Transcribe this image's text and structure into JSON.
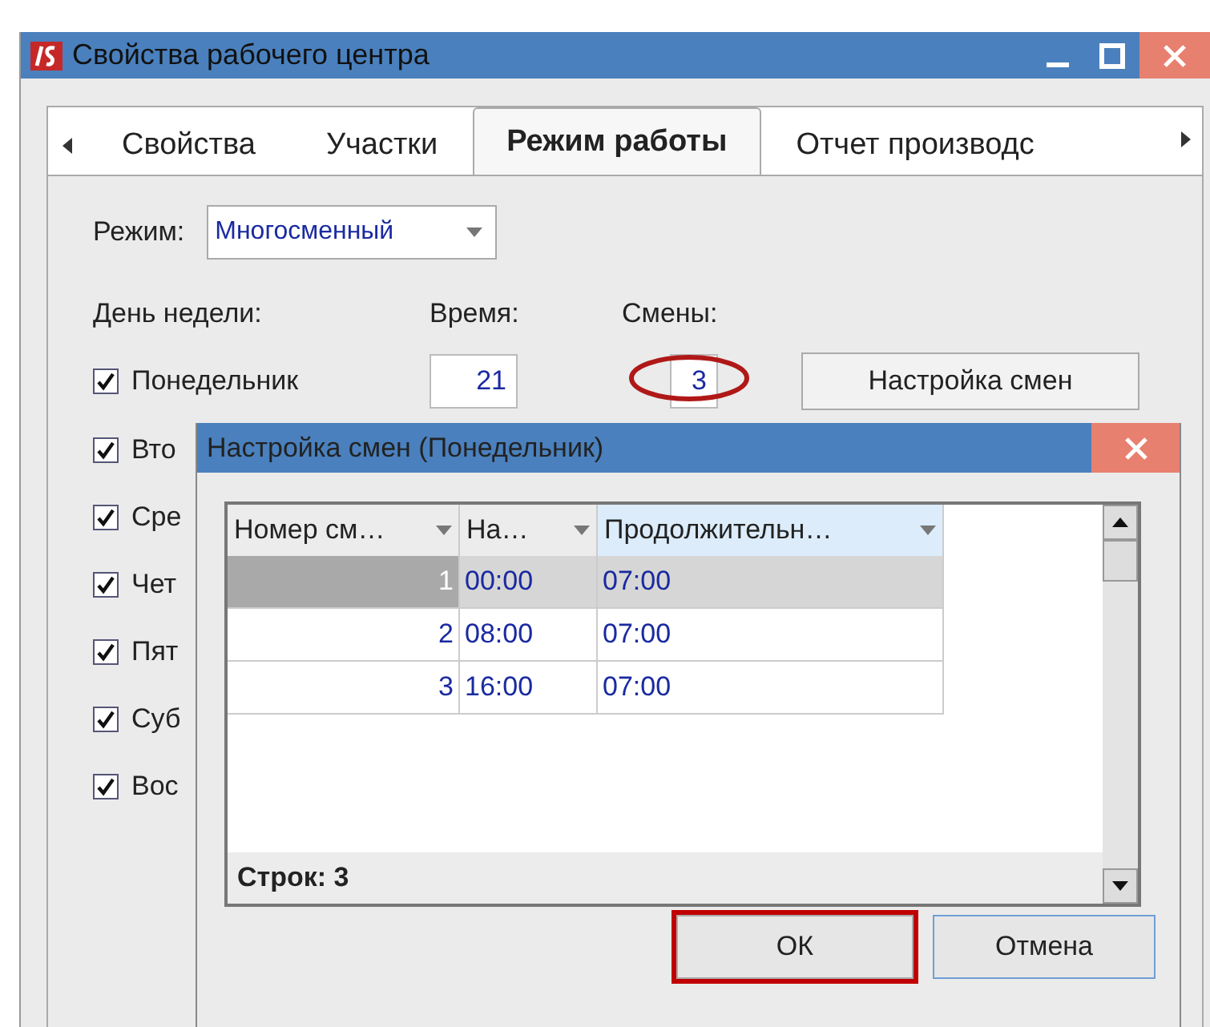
{
  "window": {
    "title": "Свойства рабочего центра"
  },
  "tabs": [
    {
      "label": "Свойства",
      "selected": false
    },
    {
      "label": "Участки",
      "selected": false
    },
    {
      "label": "Режим работы",
      "selected": true
    },
    {
      "label": "Отчет производс",
      "selected": false
    }
  ],
  "mode": {
    "label": "Режим:",
    "value": "Многосменный"
  },
  "headers": {
    "day": "День недели:",
    "time": "Время:",
    "shifts": "Смены:"
  },
  "days": [
    {
      "label": "Понедельник",
      "checked": true,
      "time": "21",
      "shifts": "3",
      "circled": true,
      "button": "Настройка смен"
    },
    {
      "label": "Вто",
      "checked": true
    },
    {
      "label": "Сре",
      "checked": true
    },
    {
      "label": "Чет",
      "checked": true
    },
    {
      "label": "Пят",
      "checked": true
    },
    {
      "label": "Суб",
      "checked": true
    },
    {
      "label": "Вос",
      "checked": true
    }
  ],
  "dialog": {
    "title": "Настройка смен (Понедельник)",
    "columns": [
      {
        "label": "Номер см…",
        "selected": false
      },
      {
        "label": "На…",
        "selected": false
      },
      {
        "label": "Продолжительн…",
        "selected": true
      }
    ],
    "rows": [
      {
        "cells": [
          "1",
          "00:00",
          "07:00"
        ],
        "selected": true
      },
      {
        "cells": [
          "2",
          "08:00",
          "07:00"
        ],
        "selected": false
      },
      {
        "cells": [
          "3",
          "16:00",
          "07:00"
        ],
        "selected": false
      }
    ],
    "footer": "Строк: 3",
    "buttons": [
      {
        "label": "ОК",
        "framed": true
      },
      {
        "label": "Отмена",
        "framed": false
      }
    ]
  }
}
